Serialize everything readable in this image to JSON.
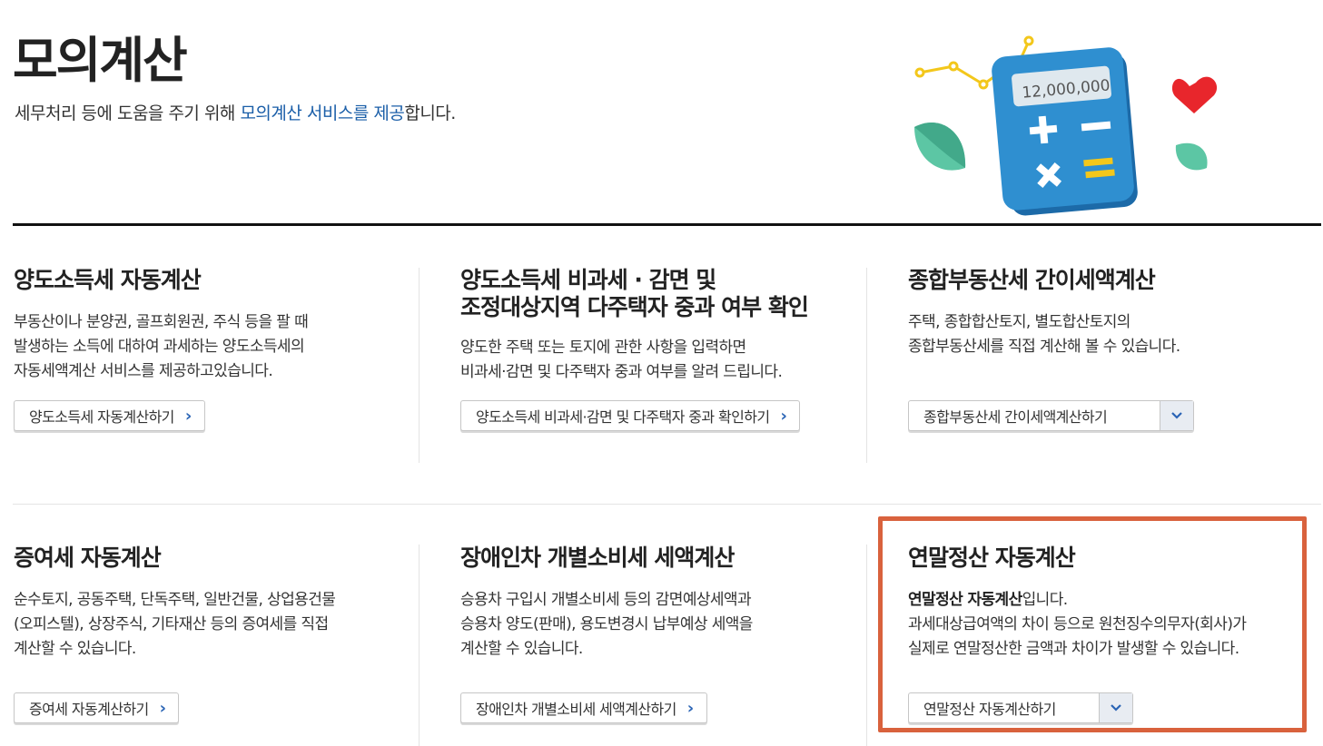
{
  "header": {
    "title": "모의계산",
    "subtitle_pre": "세무처리 등에 도움을 주기 위해 ",
    "subtitle_highlight": "모의계산 서비스를 제공",
    "subtitle_post": "합니다.",
    "illustration_amount": "12,000,000"
  },
  "cards": [
    {
      "title_line1": "양도소득세 자동계산",
      "title_line2": "",
      "desc": [
        "부동산이나 분양권, 골프회원권, 주식 등을 팔 때",
        "발생하는 소득에 대하여 과세하는 양도소득세의",
        "자동세액계산 서비스를 제공하고있습니다."
      ],
      "button": "양도소득세 자동계산하기"
    },
    {
      "title_line1": "양도소득세 비과세 · 감면 및",
      "title_line2": "조정대상지역 다주택자 중과 여부 확인",
      "desc": [
        "양도한 주택 또는 토지에 관한 사항을 입력하면",
        "비과세·감면 및 다주택자 중과 여부를 알려 드립니다."
      ],
      "button": "양도소득세 비과세·감면 및 다주택자 중과 확인하기"
    },
    {
      "title_line1": "종합부동산세 간이세액계산",
      "title_line2": "",
      "desc": [
        "주택, 종합합산토지, 별도합산토지의",
        "종합부동산세를 직접 계산해 볼 수 있습니다."
      ],
      "button": "종합부동산세 간이세액계산하기"
    },
    {
      "title_line1": "증여세 자동계산",
      "title_line2": "",
      "desc": [
        "순수토지, 공동주택, 단독주택, 일반건물, 상업용건물",
        "(오피스텔), 상장주식, 기타재산 등의 증여세를 직접",
        "계산할 수 있습니다."
      ],
      "button": "증여세 자동계산하기"
    },
    {
      "title_line1": "장애인차 개별소비세 세액계산",
      "title_line2": "",
      "desc": [
        "승용차 구입시 개별소비세 등의 감면예상세액과",
        "승용차 양도(판매), 용도변경시 납부예상 세액을",
        "계산할 수 있습니다."
      ],
      "button": "장애인차 개별소비세 세액계산하기"
    },
    {
      "title_line1": "연말정산 자동계산",
      "title_line2": "",
      "desc_highlight": "연말정산 자동계산",
      "desc_highlight_post": "입니다.",
      "desc": [
        "과세대상급여액의 차이 등으로 원천징수의무자(회사)가",
        "실제로 연말정산한 금액과 차이가 발생할 수 있습니다."
      ],
      "button": "연말정산 자동계산하기"
    }
  ],
  "icons": {
    "chevron_right": "›",
    "chevron_down": "⌄"
  },
  "colors": {
    "accent": "#1a5ea8",
    "highlight_border": "#d9623d"
  }
}
